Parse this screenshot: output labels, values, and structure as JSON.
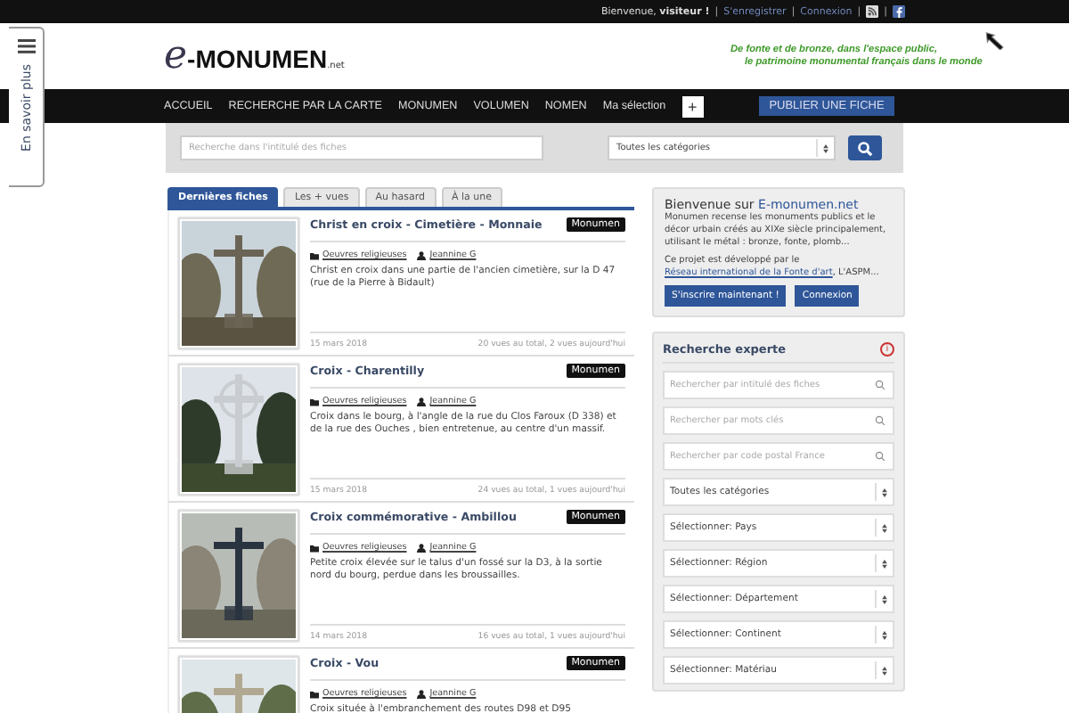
{
  "top_bar": {
    "greeting": "Bienvenue, **visiteur !**",
    "links": [
      {
        "label": "S'enregistrer"
      },
      {
        "label": "Connexion"
      }
    ],
    "separator": "|"
  },
  "side_tab": {
    "label": "En savoir plus"
  },
  "header": {
    "logo": {
      "mark": "e",
      "name": "-MONUMEN",
      "suffix": ".net"
    },
    "slogan": [
      "De fonte et de bronze, dans l'espace public,",
      "le patrimoine monumental français dans le monde"
    ]
  },
  "nav": {
    "items": [
      "ACCUEIL",
      "RECHERCHE PAR LA CARTE",
      "MONUMEN",
      "VOLUMEN",
      "NOMEN",
      "Ma sélection"
    ],
    "add_button": "+",
    "publish_button": "PUBLIER UNE FICHE"
  },
  "search": {
    "placeholder": "Recherche dans l'intitulé des fiches",
    "category": "Toutes les catégories"
  },
  "tabs": [
    {
      "label": "Dernières fiches",
      "selected": true
    },
    {
      "label": "Les + vues",
      "selected": false
    },
    {
      "label": "Au hasard",
      "selected": false
    },
    {
      "label": "À la une",
      "selected": false
    }
  ],
  "cards": [
    {
      "title": "Christ en croix - Cimetière - Monnaie",
      "badge": "Monumen",
      "category": "Oeuvres religieuses",
      "author": "Jeannine G",
      "description": "Christ en croix dans une partie de l'ancien cimetière, sur la D 47 (rue de la Pierre à Bidault)",
      "date": "15 mars 2018",
      "stats": "20 vues au total, 2 vues aujourd'hui"
    },
    {
      "title": "Croix - Charentilly",
      "badge": "Monumen",
      "category": "Oeuvres religieuses",
      "author": "Jeannine G",
      "description": "Croix dans le bourg, à l'angle de la rue du Clos Faroux (D 338) et de la rue des Ouches , bien entretenue, au centre d'un massif.",
      "date": "15 mars 2018",
      "stats": "24 vues au total, 1 vues aujourd'hui"
    },
    {
      "title": "Croix commémorative - Ambillou",
      "badge": "Monumen",
      "category": "Oeuvres religieuses",
      "author": "Jeannine G",
      "description": "Petite croix élevée sur le talus d'un fossé sur la D3, à la sortie nord du bourg, perdue dans les broussailles.",
      "date": "14 mars 2018",
      "stats": "16 vues au total, 1 vues aujourd'hui"
    },
    {
      "title": "Croix - Vou",
      "badge": "Monumen",
      "category": "Oeuvres religieuses",
      "author": "Jeannine G",
      "description": "Croix située à l'embranchement des routes D98 et D95"
    }
  ],
  "welcome": {
    "title": "Bienvenue sur",
    "title_link": "E-monumen.net",
    "body": "Monumen recense les monuments publics et le décor urbain créés au XIXe siècle principalement, utilisant le métal : bronze, fonte, plomb...",
    "project_before": "Ce projet est développé par le",
    "project_link": "Réseau international de la Fonte d'art",
    "project_after": ", L'ASPM...",
    "buttons": [
      "S'inscrire maintenant !",
      "Connexion"
    ]
  },
  "expert": {
    "title": "Recherche experte",
    "info": "i",
    "fields": [
      {
        "kind": "search",
        "placeholder": "Rechercher par intitulé des fiches"
      },
      {
        "kind": "search",
        "placeholder": "Rechercher par mots clés"
      },
      {
        "kind": "search",
        "placeholder": "Rechercher par code postal France"
      },
      {
        "kind": "select",
        "value": "Toutes les catégories"
      },
      {
        "kind": "select",
        "value": "Sélectionner: Pays"
      },
      {
        "kind": "select",
        "value": "Sélectionner: Région"
      },
      {
        "kind": "select",
        "value": "Sélectionner: Département"
      },
      {
        "kind": "select",
        "value": "Sélectionner: Continent"
      },
      {
        "kind": "select",
        "value": "Sélectionner: Matériau"
      }
    ]
  }
}
